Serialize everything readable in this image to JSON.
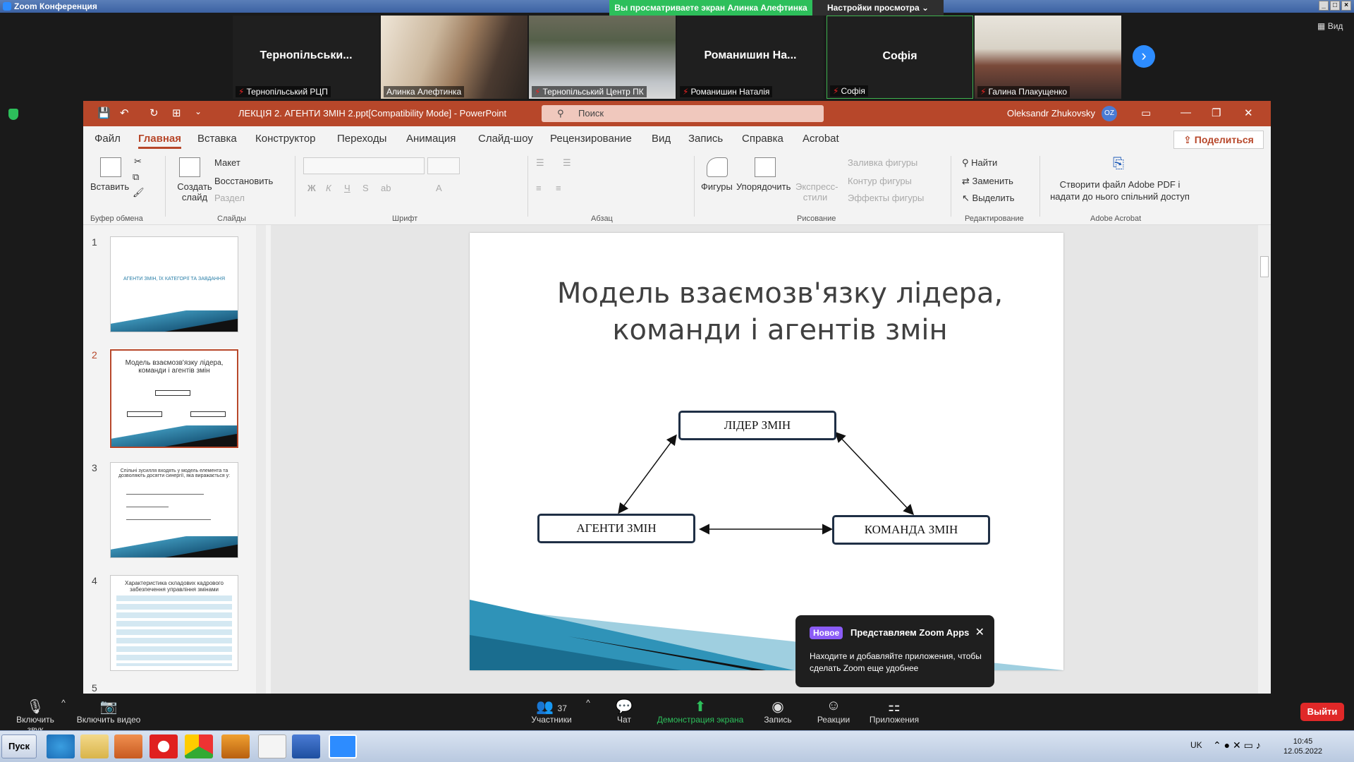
{
  "zoom_window": {
    "title": "Zoom Конференция",
    "share_banner": "Вы просматриваете экран Алинка Алефтинка",
    "view_settings": "Настройки просмотра",
    "view_label": "Вид"
  },
  "participants": [
    {
      "display": "Тернопільськи...",
      "label": "Тернопільський РЦП",
      "video": false
    },
    {
      "display": "",
      "label": "Алинка Алефтинка",
      "video": true
    },
    {
      "display": "",
      "label": "Тернопільський Центр ПК",
      "video": true
    },
    {
      "display": "Романишин  На...",
      "label": "Романишин Наталія",
      "video": false
    },
    {
      "display": "Софія",
      "label": "Софія",
      "video": false
    },
    {
      "display": "",
      "label": "Галина Плакущенко",
      "video": true
    }
  ],
  "powerpoint": {
    "doc_title": "ЛЕКЦІЯ 2. АГЕНТИ ЗМІН 2.ppt[Compatibility Mode]  -  PowerPoint",
    "search_placeholder": "Поиск",
    "user": "Oleksandr Zhukovsky",
    "user_initials": "OZ",
    "share_button": "Поделиться",
    "menu": [
      "Файл",
      "Главная",
      "Вставка",
      "Конструктор",
      "Переходы",
      "Анимация",
      "Слайд-шоу",
      "Рецензирование",
      "Вид",
      "Запись",
      "Справка",
      "Acrobat"
    ],
    "ribbon": {
      "paste": "Вставить",
      "clipboard_group": "Буфер обмена",
      "new_slide": "Создать слайд",
      "layout": "Макет",
      "reset": "Восстановить",
      "section": "Раздел",
      "slides_group": "Слайды",
      "font_group": "Шрифт",
      "paragraph_group": "Абзац",
      "shapes": "Фигуры",
      "arrange": "Упорядочить",
      "quick_styles": "Экспресс-стили",
      "shape_fill": "Заливка фигуры",
      "shape_outline": "Контур фигуры",
      "shape_effects": "Эффекты фигуры",
      "drawing_group": "Рисование",
      "find": "Найти",
      "replace": "Заменить",
      "select": "Выделить",
      "editing_group": "Редактирование",
      "acrobat_create": "Створити файл Adobe PDF і надати до нього спільний доступ",
      "acrobat_group": "Adobe Acrobat"
    },
    "thumbnails": [
      {
        "num": "1",
        "text": "АГЕНТИ ЗМІН, ЇХ КАТЕГОРІЇ ТА ЗАВДАННЯ"
      },
      {
        "num": "2",
        "text": "Модель взаємозв'язку лідера, команди і агентів змін"
      },
      {
        "num": "3",
        "text": "Спільні зусилля входять у модель елемента та дозволяють досягти синергії, яка виражається у:"
      },
      {
        "num": "4",
        "text": "Характеристика складових кадрового забезпечення управління змінами"
      },
      {
        "num": "5",
        "text": ""
      }
    ],
    "slide": {
      "title": "Модель взаємозв'язку лідера, команди і агентів змін",
      "box_leader": "ЛІДЕР ЗМІН",
      "box_agents": "АГЕНТИ ЗМІН",
      "box_team": "КОМАНДА ЗМІН"
    }
  },
  "zoom_apps_tip": {
    "badge": "Новое",
    "heading": "Представляем Zoom Apps",
    "body": "Находите и добавляйте приложения, чтобы сделать Zoom еще удобнее"
  },
  "toolbar": {
    "unmute": "Включить звук",
    "start_video": "Включить видео",
    "participants": "Участники",
    "participants_count": "37",
    "chat": "Чат",
    "share_screen": "Демонстрация экрана",
    "record": "Запись",
    "reactions": "Реакции",
    "apps": "Приложения",
    "leave": "Выйти"
  },
  "taskbar": {
    "start": "Пуск",
    "lang": "UK",
    "time": "10:45",
    "date": "12.05.2022"
  },
  "colors": {
    "ppt_accent": "#b7472a",
    "zoom_blue": "#2d8cff",
    "share_green": "#2dbf5b"
  }
}
